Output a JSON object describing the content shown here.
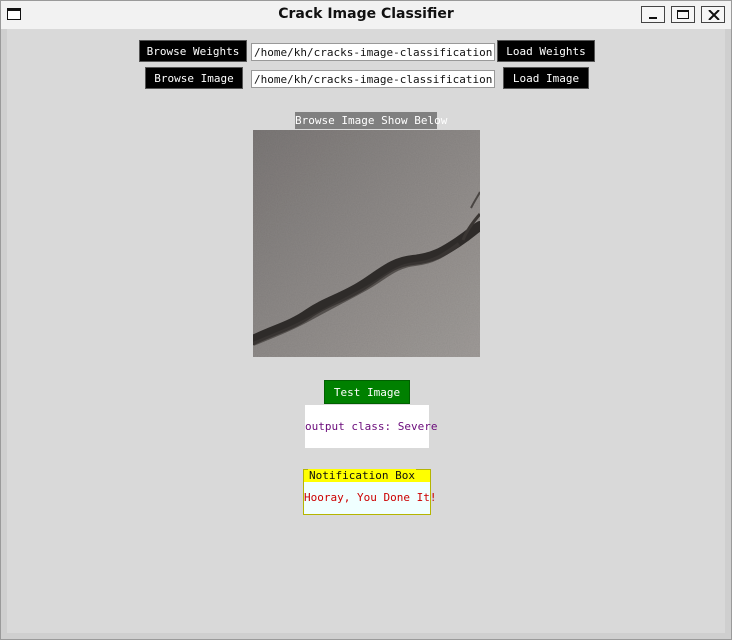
{
  "window": {
    "title": "Crack Image Classifier"
  },
  "controls": {
    "browse_weights_label": "Browse Weights",
    "weights_path": "/home/kh/cracks-image-classification-ten",
    "load_weights_label": "Load Weights",
    "browse_image_label": "Browse Image",
    "image_path": "/home/kh/cracks-image-classification-ten",
    "load_image_label": "Load Image"
  },
  "preview": {
    "caption": "Browse Image Show Below"
  },
  "test": {
    "button_label": "Test Image",
    "output_text": "output class: Severe"
  },
  "notification": {
    "legend": "Notification Box",
    "message": "Hooray, You Done It!"
  },
  "colors": {
    "window_bg": "#d9d9d9",
    "button_black": "#000000",
    "test_button_green": "#008000",
    "output_text_purple": "#6a0a7a",
    "notify_header_yellow": "#ffff00",
    "notify_message_red": "#cc0000"
  },
  "icons": [
    "app-window-icon",
    "minimize-icon",
    "maximize-icon",
    "close-icon"
  ]
}
